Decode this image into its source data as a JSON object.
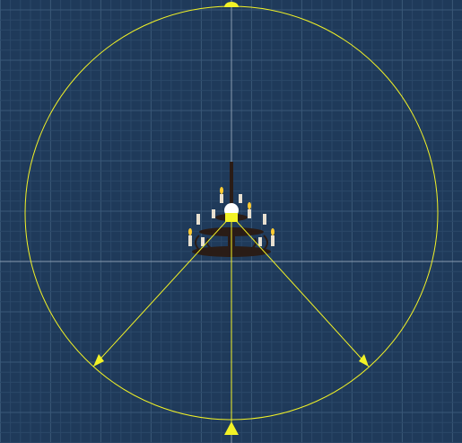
{
  "viewport": {
    "background_color": "#1f3a5a",
    "grid_minor_color": "#2b4868",
    "grid_major_color": "#3a5878",
    "axis_color": "#8a9cb0",
    "gizmo_color": "#f2f226",
    "light_center_color": "#ffffff"
  },
  "scene_object": {
    "icon": "chandelier-icon",
    "metal_color": "#2a1c16",
    "candle_color": "#e8e0d0",
    "flame_color": "#ffcc33"
  },
  "light_gizmo": {
    "type": "spot-light",
    "icons": [
      "range-handle-icon",
      "angle-handle-icon",
      "spot-light-center-icon"
    ]
  }
}
